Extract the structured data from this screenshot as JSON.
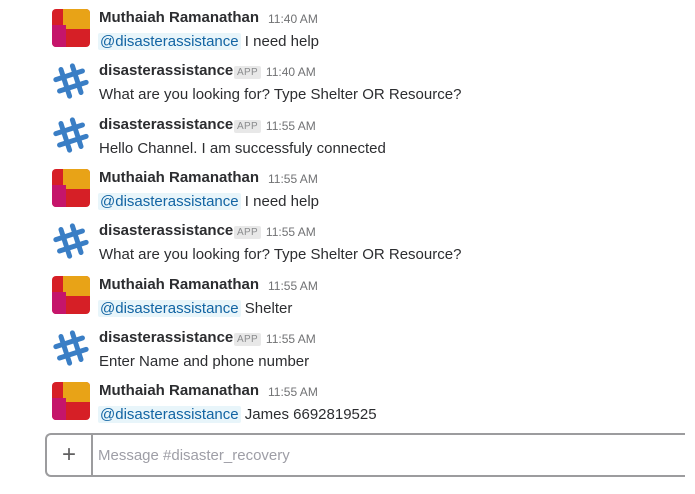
{
  "messages": [
    {
      "sender": "Muthaiah Ramanathan",
      "is_app": false,
      "time": "11:40 AM",
      "mention": "@disasterassistance",
      "text": "I need help",
      "avatar_icon": "user-avatar-icon"
    },
    {
      "sender": "disasterassistance",
      "is_app": true,
      "app_badge": "APP",
      "time": "11:40 AM",
      "mention": "",
      "text": "What are you looking for? Type Shelter OR Resource?",
      "avatar_icon": "slack-bot-icon"
    },
    {
      "sender": "disasterassistance",
      "is_app": true,
      "app_badge": "APP",
      "time": "11:55 AM",
      "mention": "",
      "text": "Hello Channel. I am successfuly connected",
      "avatar_icon": "slack-bot-icon"
    },
    {
      "sender": "Muthaiah Ramanathan",
      "is_app": false,
      "time": "11:55 AM",
      "mention": "@disasterassistance",
      "text": "I need help",
      "avatar_icon": "user-avatar-icon"
    },
    {
      "sender": "disasterassistance",
      "is_app": true,
      "app_badge": "APP",
      "time": "11:55 AM",
      "mention": "",
      "text": "What are you looking for? Type Shelter OR Resource?",
      "avatar_icon": "slack-bot-icon"
    },
    {
      "sender": "Muthaiah Ramanathan",
      "is_app": false,
      "time": "11:55 AM",
      "mention": "@disasterassistance",
      "text": "Shelter",
      "avatar_icon": "user-avatar-icon"
    },
    {
      "sender": "disasterassistance",
      "is_app": true,
      "app_badge": "APP",
      "time": "11:55 AM",
      "mention": "",
      "text": "Enter Name and phone number",
      "avatar_icon": "slack-bot-icon"
    },
    {
      "sender": "Muthaiah Ramanathan",
      "is_app": false,
      "time": "11:55 AM",
      "mention": "@disasterassistance",
      "text": "James 6692819525",
      "avatar_icon": "user-avatar-icon"
    }
  ],
  "composer": {
    "plus_label": "+",
    "placeholder": "Message #disaster_recovery",
    "value": ""
  },
  "colors": {
    "mention_bg": "#e8f5fa",
    "mention_text": "#1264a3",
    "avatar_yellow": "#e8a317",
    "avatar_red": "#d61f26",
    "avatar_pink": "#c5156b",
    "bot_blue": "#3a7ec5"
  }
}
